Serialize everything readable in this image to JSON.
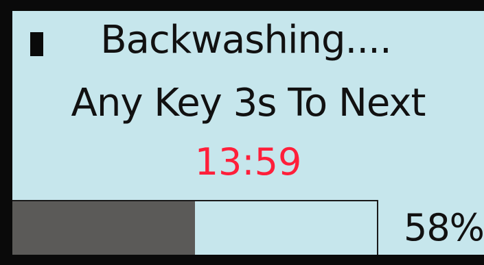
{
  "status": {
    "title": "Backwashing....",
    "hint": "Any Key 3s To Next",
    "timer": "13:59",
    "timer_color": "#ff1f3a",
    "progress_fraction": 0.5,
    "percent_label": "58%",
    "indicator_icon": "filled-square-icon"
  }
}
